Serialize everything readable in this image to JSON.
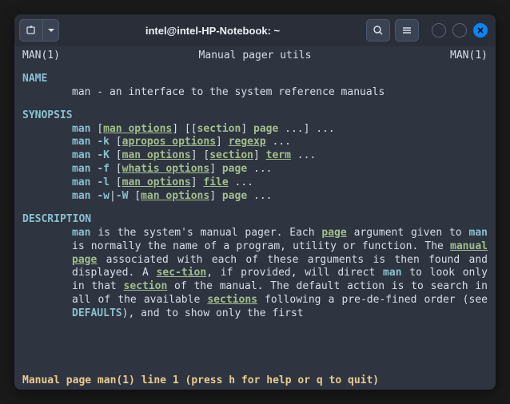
{
  "titlebar": {
    "title": "intel@intel-HP-Notebook: ~"
  },
  "header": {
    "left": "MAN(1)",
    "center": "Manual pager utils",
    "right": "MAN(1)"
  },
  "sections": {
    "name": "NAME",
    "name_line": "man - an interface to the system reference manuals",
    "synopsis": "SYNOPSIS",
    "description": "DESCRIPTION"
  },
  "syn": {
    "man": "man",
    "k": "-k",
    "K": "-K",
    "f": "-f",
    "l": "-l",
    "w": "-w",
    "W": "-W",
    "pipe": "|",
    "man_options": "man options",
    "apropos_options": "apropos options",
    "whatis_options": "whatis options",
    "section": "section",
    "page": "page",
    "term": "term",
    "file": "file",
    "regexp": "regexp",
    "dots": "...",
    "lb": "[",
    "rb": "]",
    "sp": " "
  },
  "desc": {
    "t1a": "man",
    "t1b": "  is  the system's manual pager.  Each ",
    "page": "page",
    "t1c": " argument given to ",
    "man2": "man",
    "t1d": " is normally the name of a program, utility or  function.   The ",
    "manual_page": "manual page",
    "t1e": " associated with each of these arguments is then found and  displayed.   A  ",
    "sec": "sec‐",
    "tion": "tion",
    "t1f": ", if provided, will direct ",
    "man3": "man",
    "t1g": " to look only in that ",
    "section": "section",
    "t1h": " of the manual.  The default action is to search in  all  of  the available ",
    "sections": "sections",
    "t1i": " following a pre-de‐fined order (see ",
    "defaults": "DEFAULTS",
    "t1j": "), and to show only the  first"
  },
  "status": " Manual page man(1) line 1 (press h for help or q to quit)"
}
